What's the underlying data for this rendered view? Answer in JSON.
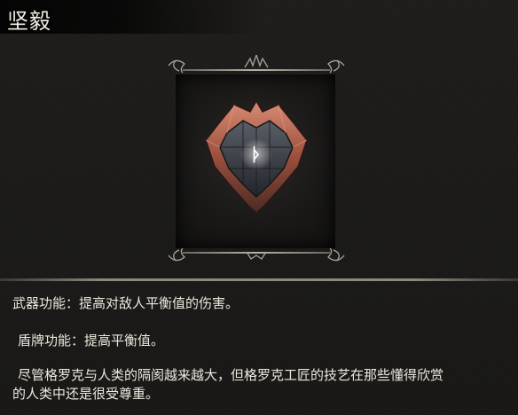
{
  "item": {
    "title": "坚毅",
    "icon": "shield-rune-icon",
    "rune_glyph": "ᚦ",
    "description": {
      "weapon_effect": "武器功能：提高对敌人平衡值的伤害。",
      "shield_effect": "盾牌功能：提高平衡值。",
      "lore_line1": "尽管格罗克与人类的隔阂越来越大，但格罗克工匠的技艺在那些懂得欣赏",
      "lore_line2": "的人类中还是很受尊重。"
    }
  },
  "colors": {
    "background": "#1b1a18",
    "text": "#e6e2d8",
    "shield_copper": "#b86a55",
    "shield_steel": "#3e434a",
    "rune_glow": "#ffffff"
  }
}
